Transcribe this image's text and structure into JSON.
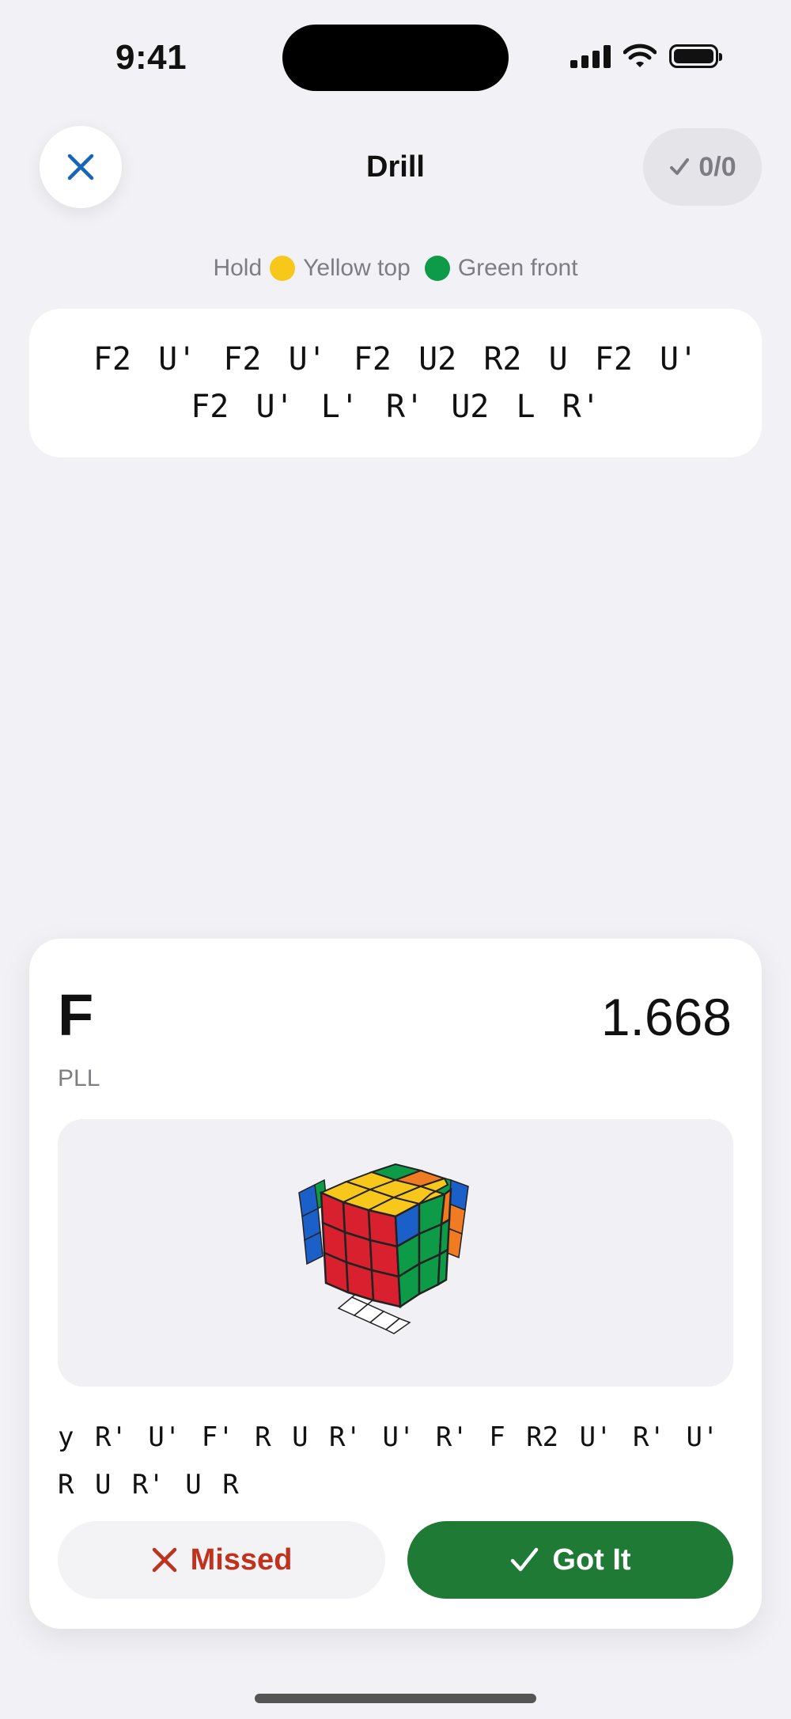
{
  "status_bar": {
    "time": "9:41"
  },
  "header": {
    "title": "Drill",
    "score": "0/0"
  },
  "hint": {
    "hold": "Hold",
    "top": "Yellow top",
    "front": "Green front"
  },
  "scramble": "F2 U' F2 U' F2 U2 R2 U F2 U' F2 U' L' R' U2 L R'",
  "case": {
    "name": "F",
    "set": "PLL",
    "time": "1.668",
    "algorithm": "y R' U' F' R U R' U' R' F R2 U' R' U' R U R' U R"
  },
  "actions": {
    "missed": "Missed",
    "got_it": "Got It"
  },
  "colors": {
    "yellow": "#f7c81b",
    "green": "#0e9b48",
    "red": "#d8202e",
    "blue": "#1b5fc9",
    "orange": "#f07b22",
    "accent_blue": "#1565c0",
    "got_it_green": "#1e7a34",
    "missed_red": "#c0321e"
  }
}
